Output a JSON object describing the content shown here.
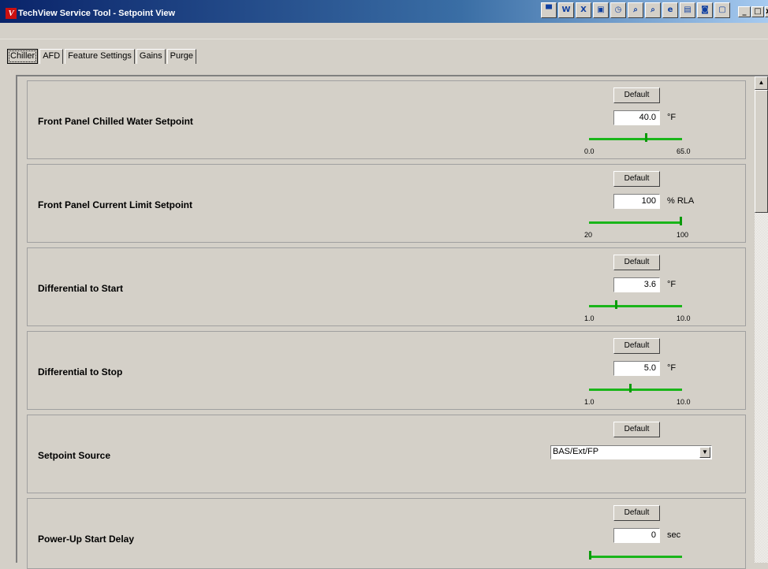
{
  "window": {
    "title": "TechView Service Tool - Setpoint View",
    "app_icon_letter": "V",
    "minimize": "_",
    "maximize": "□",
    "close": "x"
  },
  "tray_icons": [
    {
      "name": "flag-icon",
      "glyph": "▀"
    },
    {
      "name": "word-icon",
      "glyph": "W"
    },
    {
      "name": "excel-icon",
      "glyph": "X"
    },
    {
      "name": "monitor-icon",
      "glyph": "▣"
    },
    {
      "name": "clock-icon",
      "glyph": "◷"
    },
    {
      "name": "magnifier-icon",
      "glyph": "⌕"
    },
    {
      "name": "search-doc-icon",
      "glyph": "⌕"
    },
    {
      "name": "browser-icon",
      "glyph": "e"
    },
    {
      "name": "terminal-icon",
      "glyph": "▤"
    },
    {
      "name": "network-icon",
      "glyph": "◙"
    },
    {
      "name": "window-icon",
      "glyph": "▢"
    }
  ],
  "tabs": [
    {
      "label": "Chiller",
      "active": true
    },
    {
      "label": "AFD",
      "active": false
    },
    {
      "label": "Feature Settings",
      "active": false
    },
    {
      "label": "Gains",
      "active": false
    },
    {
      "label": "Purge",
      "active": false
    }
  ],
  "panels": [
    {
      "label": "Front Panel Chilled Water Setpoint",
      "default_label": "Default",
      "value": "40.0",
      "unit": "°F",
      "min": "0.0",
      "max": "65.0",
      "level": 0.615
    },
    {
      "label": "Front Panel Current Limit Setpoint",
      "default_label": "Default",
      "value": "100",
      "unit": "% RLA",
      "min": "20",
      "max": "100",
      "level": 1.0
    },
    {
      "label": "Differential to Start",
      "default_label": "Default",
      "value": "3.6",
      "unit": "°F",
      "min": "1.0",
      "max": "10.0",
      "level": 0.289
    },
    {
      "label": "Differential to Stop",
      "default_label": "Default",
      "value": "5.0",
      "unit": "°F",
      "min": "1.0",
      "max": "10.0",
      "level": 0.444
    },
    {
      "label": "Setpoint Source",
      "default_label": "Default",
      "select_value": "BAS/Ext/FP"
    },
    {
      "label": "Power-Up Start Delay",
      "default_label": "Default",
      "value": "0",
      "unit": "sec",
      "level": 0.0
    }
  ],
  "scrollbar": {
    "up_arrow": "▲"
  },
  "select_arrow": "▼"
}
